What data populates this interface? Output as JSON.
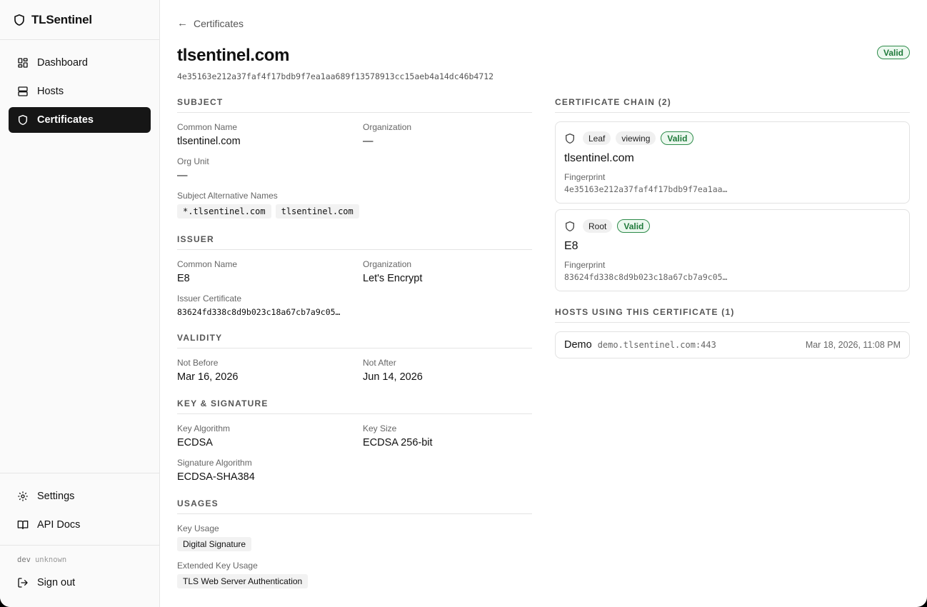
{
  "app": {
    "name": "TLSentinel"
  },
  "sidebar": {
    "items": [
      {
        "label": "Dashboard",
        "icon": "dashboard-icon",
        "active": false
      },
      {
        "label": "Hosts",
        "icon": "server-icon",
        "active": false
      },
      {
        "label": "Certificates",
        "icon": "shield-icon",
        "active": true
      }
    ],
    "bottom_items": [
      {
        "label": "Settings",
        "icon": "gear-icon"
      },
      {
        "label": "API Docs",
        "icon": "book-icon"
      }
    ],
    "version_env": "dev",
    "version_value": "unknown",
    "signout_label": "Sign out"
  },
  "breadcrumb": {
    "label": "Certificates"
  },
  "certificate": {
    "title": "tlsentinel.com",
    "hash": "4e35163e212a37faf4f17bdb9f7ea1aa689f13578913cc15aeb4a14dc46b4712",
    "status": "Valid"
  },
  "subject": {
    "heading": "Subject",
    "common_name_label": "Common Name",
    "common_name": "tlsentinel.com",
    "organization_label": "Organization",
    "organization": "—",
    "org_unit_label": "Org Unit",
    "org_unit": "—",
    "san_label": "Subject Alternative Names",
    "sans": [
      "*.tlsentinel.com",
      "tlsentinel.com"
    ]
  },
  "issuer": {
    "heading": "Issuer",
    "common_name_label": "Common Name",
    "common_name": "E8",
    "organization_label": "Organization",
    "organization": "Let's Encrypt",
    "issuer_cert_label": "Issuer Certificate",
    "issuer_cert": "83624fd338c8d9b023c18a67cb7a9c05…"
  },
  "validity": {
    "heading": "Validity",
    "not_before_label": "Not Before",
    "not_before": "Mar 16, 2026",
    "not_after_label": "Not After",
    "not_after": "Jun 14, 2026"
  },
  "key_signature": {
    "heading": "Key & Signature",
    "key_algorithm_label": "Key Algorithm",
    "key_algorithm": "ECDSA",
    "key_size_label": "Key Size",
    "key_size": "ECDSA 256-bit",
    "signature_algorithm_label": "Signature Algorithm",
    "signature_algorithm": "ECDSA-SHA384"
  },
  "usages": {
    "heading": "Usages",
    "key_usage_label": "Key Usage",
    "key_usage": "Digital Signature",
    "ext_key_usage_label": "Extended Key Usage",
    "ext_key_usage": "TLS Web Server Authentication"
  },
  "chain": {
    "heading": "Certificate Chain (2)",
    "fingerprint_label": "Fingerprint",
    "items": [
      {
        "role": "Leaf",
        "viewing": "viewing",
        "status": "Valid",
        "name": "tlsentinel.com",
        "fingerprint": "4e35163e212a37faf4f17bdb9f7ea1aa…"
      },
      {
        "role": "Root",
        "status": "Valid",
        "name": "E8",
        "fingerprint": "83624fd338c8d9b023c18a67cb7a9c05…"
      }
    ]
  },
  "hosts": {
    "heading": "Hosts Using This Certificate (1)",
    "items": [
      {
        "name": "Demo",
        "address": "demo.tlsentinel.com:443",
        "date": "Mar 18, 2026, 11:08 PM"
      }
    ]
  },
  "colors": {
    "valid_green": "#1f7a3a",
    "active_nav": "#161616"
  }
}
